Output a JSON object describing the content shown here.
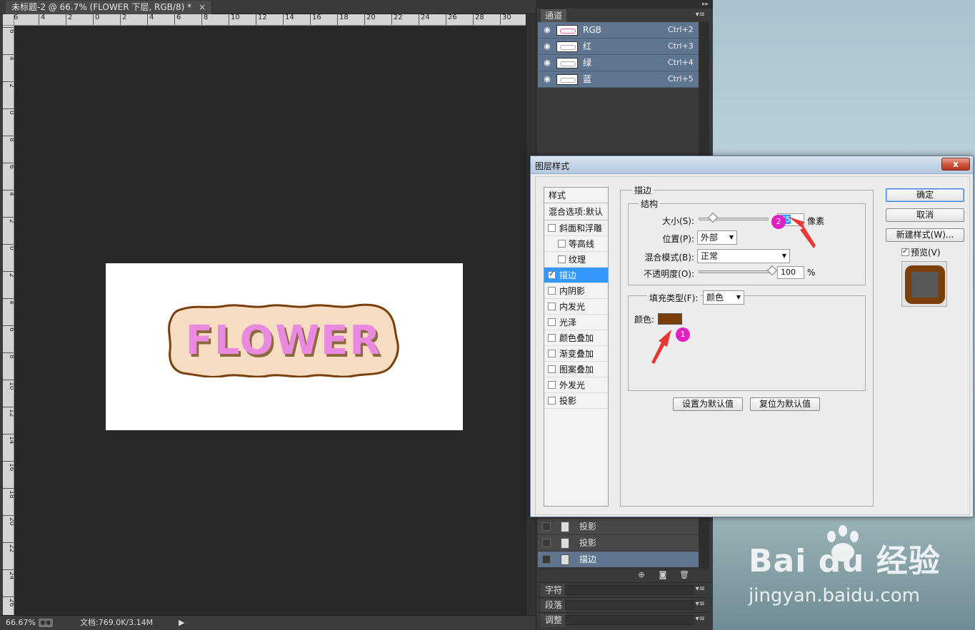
{
  "document": {
    "tab_title": "未标题-2 @ 66.7% (FLOWER 下层, RGB/8) *",
    "close_glyph": "×",
    "canvas_text": "FLOWER"
  },
  "rulers": {
    "top_labels": [
      "6",
      "4",
      "2",
      "0",
      "2",
      "4",
      "6",
      "8",
      "10",
      "12",
      "14",
      "16",
      "18",
      "20",
      "22",
      "24",
      "26",
      "28",
      "30"
    ],
    "left_labels": [
      "6",
      "4",
      "2",
      "0",
      "8",
      "6",
      "4",
      "2",
      "0",
      "2",
      "4",
      "6",
      "8",
      "10",
      "12",
      "14",
      "16",
      "18",
      "20",
      "22",
      "24",
      "26"
    ]
  },
  "status": {
    "zoom": "66.67%",
    "doc_info": "文档:769.0K/3.14M",
    "arrow": "▶"
  },
  "channels_panel": {
    "tab": "通道",
    "collapse": "▸▸",
    "menu": "▾≡",
    "eye": "◉",
    "rows": [
      {
        "name": "RGB",
        "key": "Ctrl+2"
      },
      {
        "name": "红",
        "key": "Ctrl+3"
      },
      {
        "name": "绿",
        "key": "Ctrl+4"
      },
      {
        "name": "蓝",
        "key": "Ctrl+5"
      }
    ]
  },
  "layers_panel": {
    "rows": [
      {
        "name": "投影",
        "selected": false
      },
      {
        "name": "投影",
        "selected": false
      },
      {
        "name": "描边",
        "selected": true
      }
    ],
    "tools": [
      "⊕",
      "◙",
      "🗑"
    ]
  },
  "collapsed_panels": [
    {
      "tab": "字符"
    },
    {
      "tab": "段落"
    },
    {
      "tab": "调整"
    }
  ],
  "dialog": {
    "title": "图层样式",
    "close": "x",
    "styles_header": "样式",
    "blend_options": "混合选项:默认",
    "style_items": [
      {
        "label": "斜面和浮雕",
        "checked": false,
        "sub": false,
        "active": false
      },
      {
        "label": "等高线",
        "checked": false,
        "sub": true,
        "active": false
      },
      {
        "label": "纹理",
        "checked": false,
        "sub": true,
        "active": false
      },
      {
        "label": "描边",
        "checked": true,
        "sub": false,
        "active": true
      },
      {
        "label": "内阴影",
        "checked": false,
        "sub": false,
        "active": false
      },
      {
        "label": "内发光",
        "checked": false,
        "sub": false,
        "active": false
      },
      {
        "label": "光泽",
        "checked": false,
        "sub": false,
        "active": false
      },
      {
        "label": "颜色叠加",
        "checked": false,
        "sub": false,
        "active": false
      },
      {
        "label": "渐变叠加",
        "checked": false,
        "sub": false,
        "active": false
      },
      {
        "label": "图案叠加",
        "checked": false,
        "sub": false,
        "active": false
      },
      {
        "label": "外发光",
        "checked": false,
        "sub": false,
        "active": false
      },
      {
        "label": "投影",
        "checked": false,
        "sub": false,
        "active": false
      }
    ],
    "stroke": {
      "section": "描边",
      "structure": "结构",
      "size_label": "大小(S):",
      "size_value": "45",
      "size_unit": "像素",
      "size_slider": 0.2,
      "position_label": "位置(P):",
      "position_value": "外部",
      "blend_label": "混合模式(B):",
      "blend_value": "正常",
      "opacity_label": "不透明度(O):",
      "opacity_value": "100",
      "opacity_unit": "%",
      "opacity_slider": 1.0,
      "fill_type_label": "填充类型(F):",
      "fill_type_value": "颜色",
      "color_label": "颜色:",
      "color_hex": "#7a3e08",
      "set_default": "设置为默认值",
      "reset_default": "复位为默认值"
    },
    "buttons": {
      "ok": "确定",
      "cancel": "取消",
      "new_style": "新建样式(W)...",
      "preview": "预览(V)"
    },
    "markers": [
      "1",
      "2"
    ]
  },
  "watermark": {
    "logo": "Bai du 经验",
    "url": "jingyan.baidu.com"
  },
  "colors": {
    "accent": "#3399ff",
    "selection": "#5f7590",
    "stroke_brown": "#7a3e08",
    "text_pink": "#e989df",
    "badge_fill": "#f6dcc3",
    "marker": "#e020c0",
    "arrow": "#e53935"
  }
}
